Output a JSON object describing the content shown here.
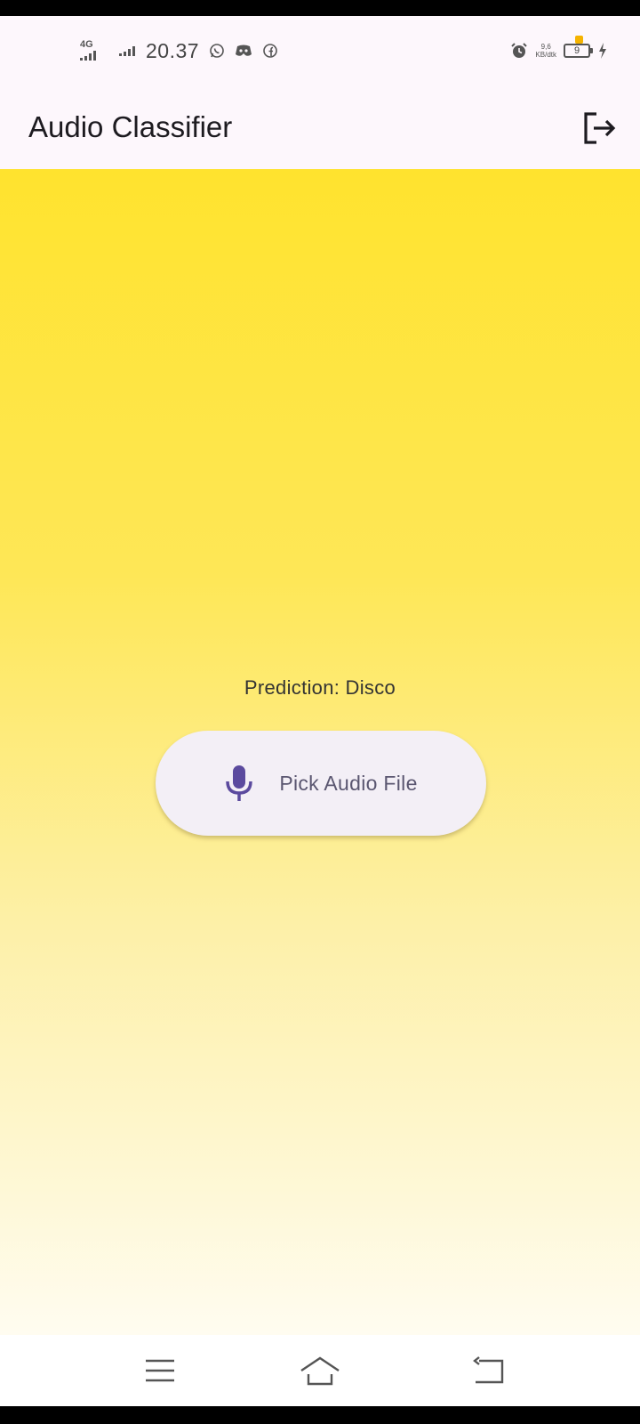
{
  "status_bar": {
    "network_type": "4G",
    "time": "20.37",
    "net_speed_value": "9,6",
    "net_speed_unit": "KB/dtk",
    "battery_level": "9",
    "icons": [
      "signal-icon",
      "whatsapp-icon",
      "discord-icon",
      "facebook-icon",
      "alarm-icon",
      "battery-icon",
      "charging-icon"
    ]
  },
  "app_bar": {
    "title": "Audio Classifier",
    "action_icon": "logout-icon"
  },
  "main": {
    "prediction_text": "Prediction: Disco",
    "pick_button": {
      "label": "Pick Audio File",
      "icon": "microphone-icon"
    }
  },
  "nav_bar": {
    "buttons": [
      "menu-icon",
      "home-icon",
      "back-icon"
    ]
  },
  "colors": {
    "gradient_top": "#ffe32e",
    "gradient_bottom": "#fffcf0",
    "button_bg": "#f3eff6",
    "accent": "#5b4a9e",
    "app_bar_bg": "#fdf7fc"
  }
}
